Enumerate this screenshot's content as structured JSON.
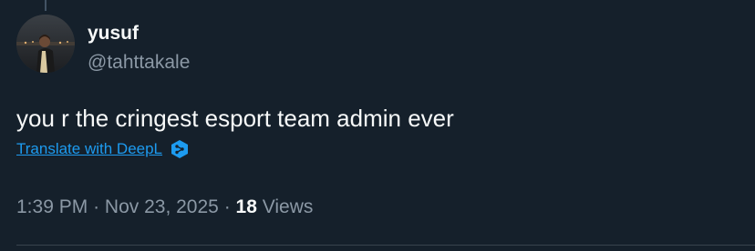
{
  "author": {
    "display_name": "yusuf",
    "handle": "@tahttakale"
  },
  "tweet": {
    "text": "you r the cringest esport team admin ever",
    "translate_label": "Translate with DeepL",
    "time": "1:39 PM",
    "separator": "·",
    "date": "Nov 23, 2025",
    "views_count": "18",
    "views_label": "Views"
  },
  "colors": {
    "background": "#15202b",
    "text_primary": "#f7f9f9",
    "text_secondary": "#8b98a5",
    "link": "#1d9bf0"
  },
  "icons": {
    "avatar": "profile-photo",
    "translate": "deepl-icon"
  }
}
